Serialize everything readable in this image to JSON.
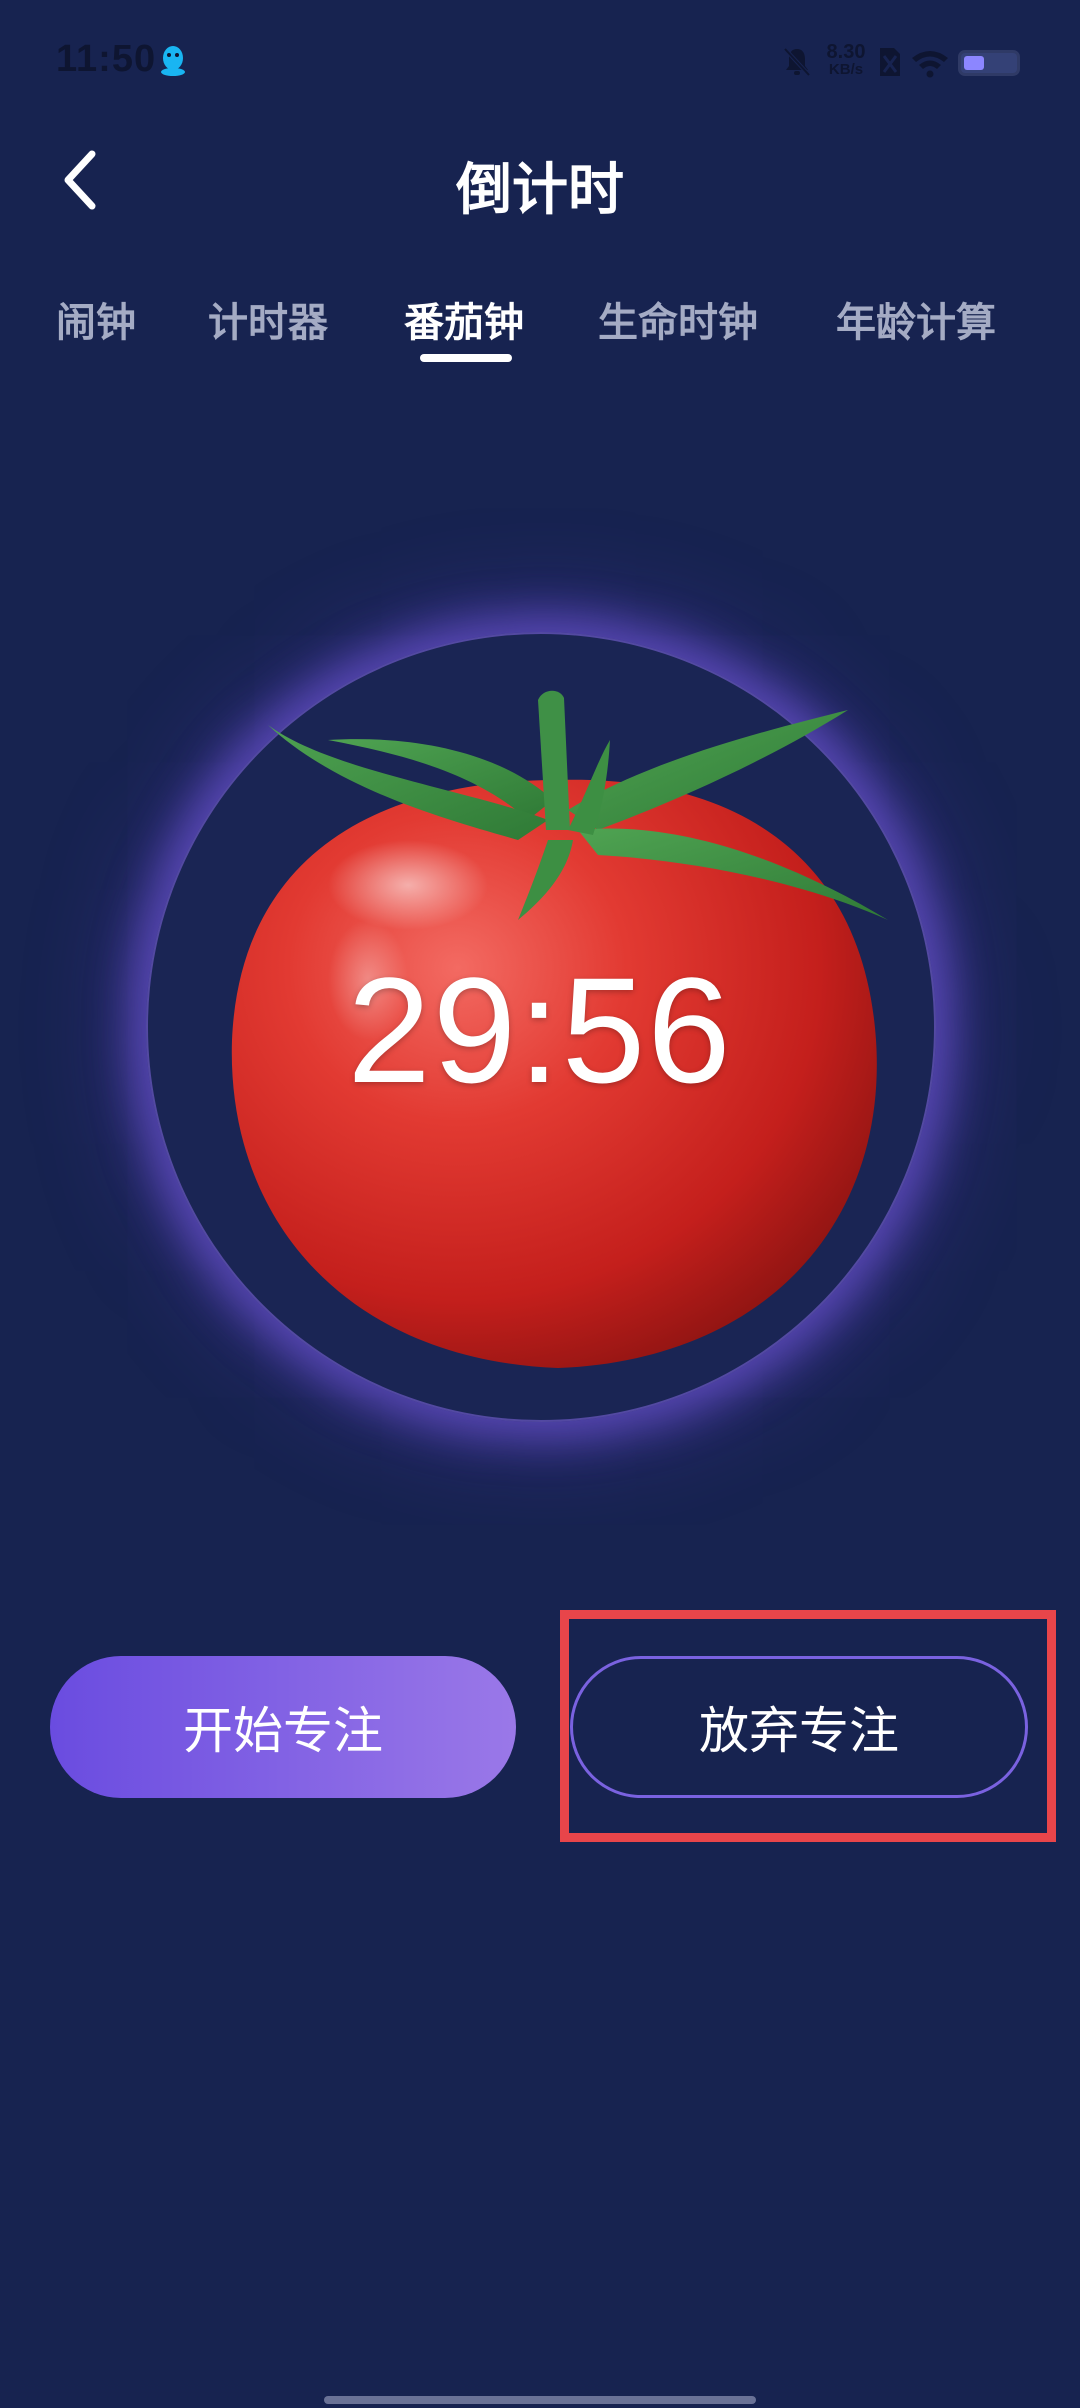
{
  "status_bar": {
    "time": "11:50",
    "net_speed_value": "8.30",
    "net_speed_unit": "KB/s",
    "battery_level": 0.4,
    "icons": [
      "qq-icon",
      "mute-icon",
      "sim-icon",
      "wifi-icon",
      "battery-icon"
    ]
  },
  "header": {
    "title": "倒计时",
    "back_icon": "chevron-left-icon"
  },
  "tabs": [
    {
      "label": "闹钟",
      "active": false
    },
    {
      "label": "计时器",
      "active": false
    },
    {
      "label": "番茄钟",
      "active": true
    },
    {
      "label": "生命时钟",
      "active": false
    },
    {
      "label": "年龄计算",
      "active": false
    }
  ],
  "timer": {
    "remaining": "29:56",
    "image": "tomato-icon"
  },
  "actions": {
    "start_label": "开始专注",
    "abandon_label": "放弃专注"
  },
  "colors": {
    "background": "#172350",
    "accent_start": "#6a4ce0",
    "accent_end": "#9a78e8",
    "highlight": "#e8454a"
  }
}
